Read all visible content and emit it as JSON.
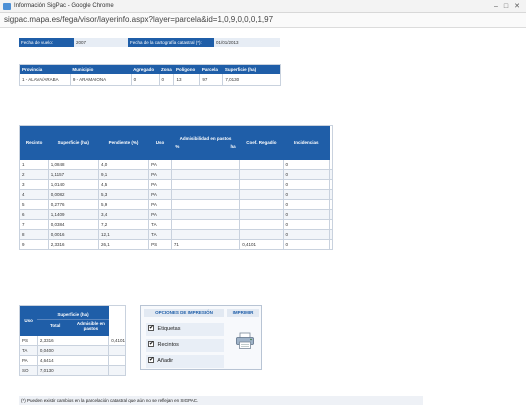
{
  "window": {
    "title": "Información SigPac - Google Chrome",
    "url": "sigpac.mapa.es/fega/visor/layerinfo.aspx?layer=parcela&id=1,0,9,0,0,0,1,97"
  },
  "info_row": {
    "label1": "Fecha de vuelo:",
    "value1": "2007",
    "label2": "Fecha de la cartografía catastral (*):",
    "value2": "01/01/2013"
  },
  "parcel_table": {
    "headers": [
      "Provincia",
      "Municipio",
      "Agregado",
      "Zona",
      "Polígono",
      "Parcela",
      "Superficie (ha)"
    ],
    "row": [
      "1 - ALAVA/ARABA",
      "9 - ARAMAIONA",
      "0",
      "0",
      "13",
      "97",
      "7,0130"
    ]
  },
  "recintos_table": {
    "headers": [
      "Recinto",
      "Superficie (ha)",
      "Pendiente (%)",
      "Uso",
      "Admisibilidad en pastos",
      "Coef. Regadío",
      "Incidencias"
    ],
    "sub_headers": [
      "%",
      "ha"
    ],
    "rows": [
      [
        "1",
        "1,0848",
        "4,0",
        "PA",
        "",
        "",
        "0",
        ""
      ],
      [
        "2",
        "1,1157",
        "9,1",
        "PA",
        "",
        "",
        "0",
        ""
      ],
      [
        "3",
        "1,0140",
        "4,5",
        "PA",
        "",
        "",
        "0",
        ""
      ],
      [
        "4",
        "0,0082",
        "5,3",
        "PA",
        "",
        "",
        "0",
        ""
      ],
      [
        "5",
        "0,2776",
        "5,9",
        "PA",
        "",
        "",
        "0",
        ""
      ],
      [
        "6",
        "1,1409",
        "3,4",
        "PA",
        "",
        "",
        "0",
        ""
      ],
      [
        "7",
        "0,0384",
        "7,2",
        "TA",
        "",
        "",
        "0",
        ""
      ],
      [
        "8",
        "0,0016",
        "12,1",
        "TA",
        "",
        "",
        "0",
        ""
      ],
      [
        "9",
        "2,3316",
        "26,1",
        "PS",
        "71",
        "0,4101",
        "0",
        ""
      ]
    ]
  },
  "uso_table": {
    "headers": [
      "Uso",
      "Superficie (ha)",
      "Total",
      "Admisible en pastos"
    ],
    "rows": [
      [
        "PS",
        "2,3316",
        "0,4101"
      ],
      [
        "TA",
        "0,0400",
        ""
      ],
      [
        "PA",
        "4,6414",
        ""
      ],
      [
        "SO",
        "7,0130",
        ""
      ]
    ]
  },
  "print_panel": {
    "options_title": "OPCIONES DE IMPRESIÓN",
    "print_title": "IMPRIMIR",
    "options": [
      "Etiquetas",
      "Recintos",
      "Añadir"
    ],
    "printer_icon": "printer-icon"
  },
  "footnote": "(*) Pueden existir cambios en la parcelación catastral que aún no se reflejan en SIGPAC.",
  "colors": {
    "header_bg": "#1f5ea8",
    "header_text": "#ffffff",
    "row_alt": "#f2f5f9"
  }
}
